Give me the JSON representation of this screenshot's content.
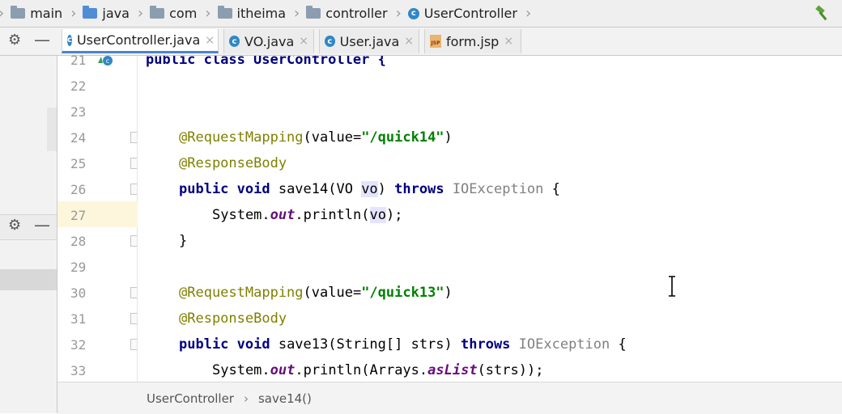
{
  "nav": {
    "items": [
      {
        "label": "main",
        "icon": "folder-icon"
      },
      {
        "label": "java",
        "icon": "source-folder-icon"
      },
      {
        "label": "com",
        "icon": "package-icon"
      },
      {
        "label": "itheima",
        "icon": "package-icon"
      },
      {
        "label": "controller",
        "icon": "package-icon"
      },
      {
        "label": "UserController",
        "icon": "class-icon"
      }
    ],
    "build_icon": "hammer-icon"
  },
  "tabs": [
    {
      "label": "UserController.java",
      "icon": "class-icon",
      "close": "×",
      "active": true
    },
    {
      "label": "VO.java",
      "icon": "class-icon",
      "close": "×",
      "active": false
    },
    {
      "label": "User.java",
      "icon": "class-icon",
      "close": "×",
      "active": false
    },
    {
      "label": "form.jsp",
      "icon": "jsp-icon",
      "close": "×",
      "active": false
    }
  ],
  "code": {
    "line_numbers": [
      "21",
      "22",
      "23",
      "24",
      "25",
      "26",
      "27",
      "28",
      "29",
      "30",
      "31",
      "32",
      "33"
    ],
    "line21": "public class UserController {",
    "line24_ann": "@RequestMapping",
    "line24_open": "(value=",
    "line24_str": "\"/quick14\"",
    "line24_close": ")",
    "line25": "@ResponseBody",
    "line26_kw1": "public void",
    "line26_mid": " save14(VO ",
    "line26_var": "vo",
    "line26_end": ") ",
    "line26_throws": "throws",
    "line26_exc": " IOException",
    "line26_brace": " {",
    "line27_a": "System.",
    "line27_out": "out",
    "line27_b": ".println(",
    "line27_var": "vo",
    "line27_c": ");",
    "line28": "}",
    "line30_ann": "@RequestMapping",
    "line30_open": "(value=",
    "line30_str": "\"/quick13\"",
    "line30_close": ")",
    "line31": "@ResponseBody",
    "line32_kw1": "public void",
    "line32_mid": " save13(String[] strs) ",
    "line32_throws": "throws",
    "line32_exc": " IOException",
    "line32_brace": " {",
    "line33_a": "System.",
    "line33_out": "out",
    "line33_b": ".println(Arrays.",
    "line33_aslist": "asList",
    "line33_c": "(strs));"
  },
  "status": {
    "class_name": "UserController",
    "sep": "›",
    "method": "save14()"
  }
}
